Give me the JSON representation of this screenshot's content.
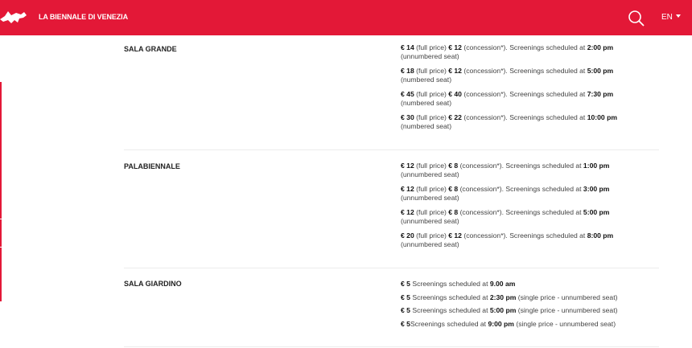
{
  "header": {
    "brand": "LA BIENNALE DI VENEZIA",
    "language": "EN",
    "accent": "#e31837"
  },
  "venues": [
    {
      "name": "SALA GRANDE",
      "entries": [
        {
          "p": [
            "€ 14",
            "  (full price)  ",
            "€ 12",
            "  (concession*). Screenings scheduled at ",
            "2:00 pm",
            " (unnumbered seat)"
          ]
        },
        {
          "p": [
            "€ 18",
            "  (full price) ",
            "€ 12",
            "  (concession*). Screenings scheduled at ",
            "5:00 pm",
            " (numbered seat)"
          ]
        },
        {
          "p": [
            "€ 45",
            "  (full price)  ",
            "€ 40",
            " (concession*). Screenings scheduled at ",
            "7:30 pm",
            " (numbered seat)"
          ]
        },
        {
          "p": [
            "€ 30",
            "  (full price)  ",
            "€ 22",
            " (concession*). Screenings scheduled at ",
            "10:00 pm",
            " (numbered seat)"
          ]
        }
      ]
    },
    {
      "name": "PALABIENNALE",
      "entries": [
        {
          "p": [
            "€ 12",
            " (full price)   ",
            "€ 8",
            " (concession*). Screenings scheduled at ",
            "1:00 pm",
            "  (unnumbered seat)"
          ]
        },
        {
          "p": [
            "€ 12",
            " (full price)   ",
            "€ 8",
            " (concession*). Screenings scheduled at ",
            "3:00 pm",
            " (unnumbered seat)"
          ]
        },
        {
          "p": [
            "€ 12",
            " (full price)   ",
            "€ 8",
            " (concession*). Screenings scheduled at ",
            "5:00 pm",
            " (unnumbered seat)"
          ]
        },
        {
          "p": [
            "€ 20",
            " (full price)   ",
            "€ 12",
            "  (concession*). Screenings scheduled at ",
            "8:00 pm",
            " (unnumbered seat)"
          ]
        }
      ]
    },
    {
      "name": "SALA GIARDINO",
      "entries": [
        {
          "p": [
            "€ 5",
            " Screenings scheduled at ",
            "9.00 am",
            ""
          ]
        },
        {
          "p": [
            "€ 5",
            " Screenings scheduled at ",
            "2:30 pm",
            " (single price  - unnumbered seat)"
          ]
        },
        {
          "p": [
            "€ 5",
            " Screenings scheduled at ",
            "5:00 pm",
            " (single price  - unnumbered seat)"
          ]
        },
        {
          "p": [
            "€ 5",
            "Screenings scheduled at ",
            "9:00 pm",
            " (single price  - unnumbered seat)"
          ]
        }
      ]
    }
  ]
}
